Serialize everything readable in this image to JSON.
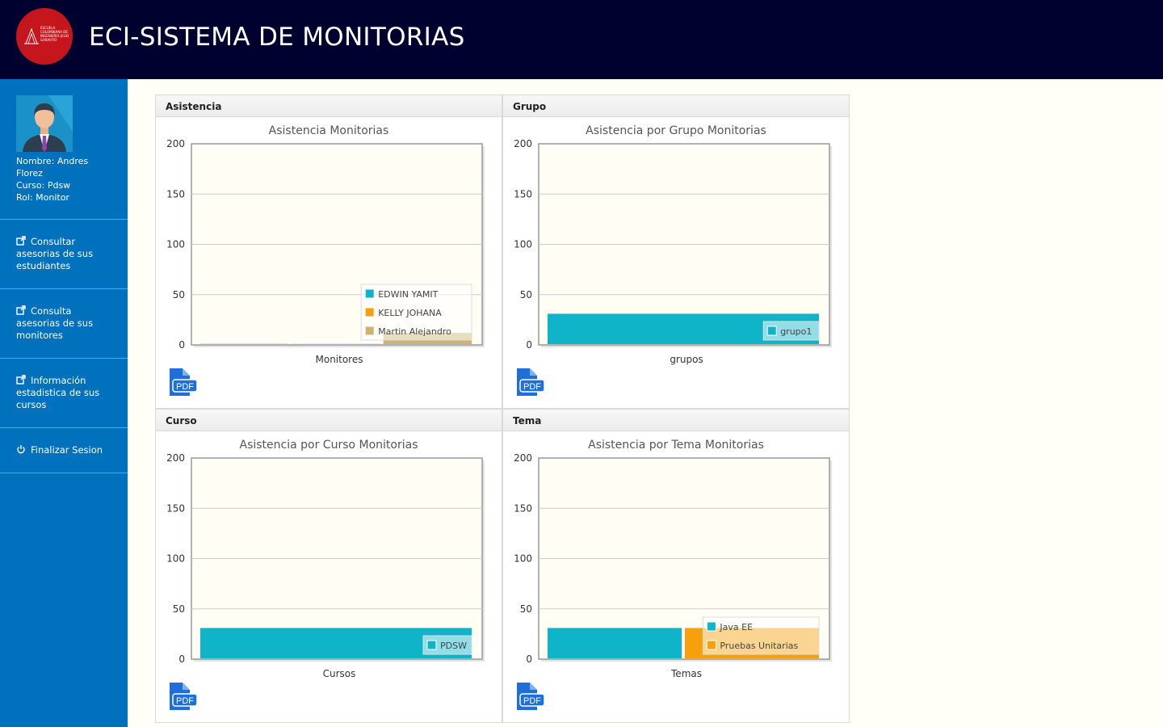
{
  "header": {
    "title": "ECI-SISTEMA DE MONITORIAS",
    "logo_text": "ESCUELA COLOMBIANA DE INGENIERÍA JULIO GARAVITO"
  },
  "profile": {
    "name_line": "Nombre: Andres Florez",
    "course_line": "Curso: Pdsw",
    "role_line": "Rol: Monitor"
  },
  "nav": [
    {
      "label": "Consultar asesorias de sus estudiantes",
      "icon": "external-link-icon"
    },
    {
      "label": "Consulta asesorias de sus monitores",
      "icon": "external-link-icon"
    },
    {
      "label": "Información estadistica de sus cursos",
      "icon": "external-link-icon"
    },
    {
      "label": "Finalizar Sesion",
      "icon": "power-icon"
    }
  ],
  "colors": {
    "header_bg": "#01012f",
    "sidebar_bg": "#0071bc",
    "plot_bg": "#fffdf4",
    "series": [
      "#0fb4c8",
      "#f5a00c",
      "#c9b474"
    ]
  },
  "panels": [
    {
      "key": "asistencia",
      "header": "Asistencia"
    },
    {
      "key": "grupo",
      "header": "Grupo"
    },
    {
      "key": "curso",
      "header": "Curso"
    },
    {
      "key": "tema",
      "header": "Tema"
    }
  ],
  "pdf_label": "PDF",
  "chart_data": [
    {
      "type": "bar",
      "title": "Asistencia Monitorias",
      "xlabel": "Monitores",
      "ylabel": "",
      "ylim": [
        0,
        200
      ],
      "yticks": [
        0,
        50,
        100,
        150,
        200
      ],
      "grid": true,
      "legend_position": "bottom-right",
      "series": [
        {
          "name": "EDWIN YAMIT",
          "values": [
            1
          ]
        },
        {
          "name": "KELLY JOHANA",
          "values": [
            1
          ]
        },
        {
          "name": "Martin Alejandro",
          "values": [
            12
          ]
        }
      ]
    },
    {
      "type": "bar",
      "title": "Asistencia por Grupo Monitorias",
      "xlabel": "grupos",
      "ylabel": "",
      "ylim": [
        0,
        200
      ],
      "yticks": [
        0,
        50,
        100,
        150,
        200
      ],
      "grid": true,
      "legend_position": "bottom-right",
      "series": [
        {
          "name": "grupo1",
          "values": [
            31
          ]
        }
      ]
    },
    {
      "type": "bar",
      "title": "Asistencia por Curso Monitorias",
      "xlabel": "Cursos",
      "ylabel": "",
      "ylim": [
        0,
        200
      ],
      "yticks": [
        0,
        50,
        100,
        150,
        200
      ],
      "grid": true,
      "legend_position": "bottom-right",
      "series": [
        {
          "name": "PDSW",
          "values": [
            31
          ]
        }
      ]
    },
    {
      "type": "bar",
      "title": "Asistencia por Tema Monitorias",
      "xlabel": "Temas",
      "ylabel": "",
      "ylim": [
        0,
        200
      ],
      "yticks": [
        0,
        50,
        100,
        150,
        200
      ],
      "grid": true,
      "legend_position": "bottom-right",
      "series": [
        {
          "name": "Java EE",
          "values": [
            31
          ]
        },
        {
          "name": "Pruebas Unitarias",
          "values": [
            31
          ]
        }
      ]
    }
  ]
}
